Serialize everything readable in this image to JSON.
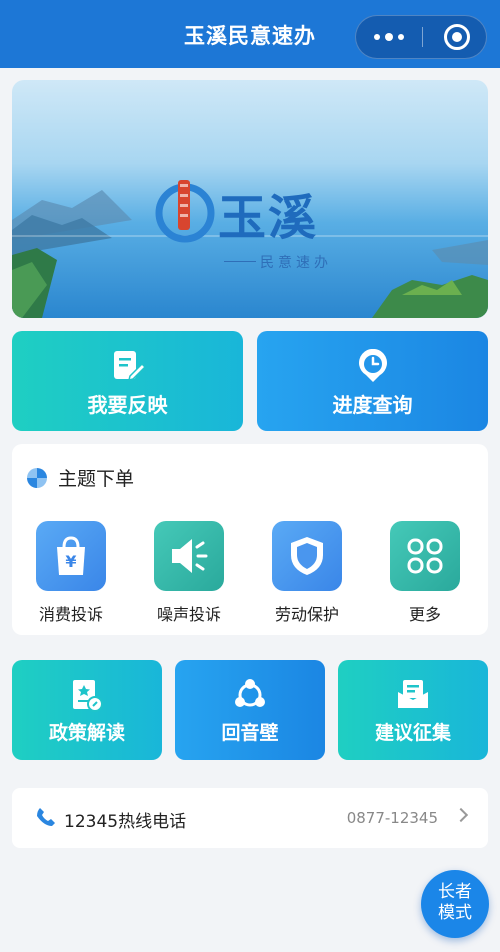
{
  "nav": {
    "title": "玉溪民意速办"
  },
  "banner": {
    "logo_text": "玉溪",
    "logo_sub": "民意速办"
  },
  "primary": [
    {
      "label": "我要反映",
      "icon": "edit-icon"
    },
    {
      "label": "进度查询",
      "icon": "clock-pin-icon"
    }
  ],
  "theme": {
    "title": "主题下单",
    "items": [
      {
        "label": "消费投诉",
        "icon": "shopping-bag-yen-icon"
      },
      {
        "label": "噪声投诉",
        "icon": "speaker-icon"
      },
      {
        "label": "劳动保护",
        "icon": "shield-icon"
      },
      {
        "label": "更多",
        "icon": "grid-more-icon"
      }
    ]
  },
  "secondary": [
    {
      "label": "政策解读",
      "icon": "document-star-icon"
    },
    {
      "label": "回音壁",
      "icon": "share-nodes-icon"
    },
    {
      "label": "建议征集",
      "icon": "mailbox-icon"
    }
  ],
  "hotline": {
    "label": "12345热线电话",
    "number": "0877-12345"
  },
  "elder_mode": {
    "line1": "长者",
    "line2": "模式"
  }
}
